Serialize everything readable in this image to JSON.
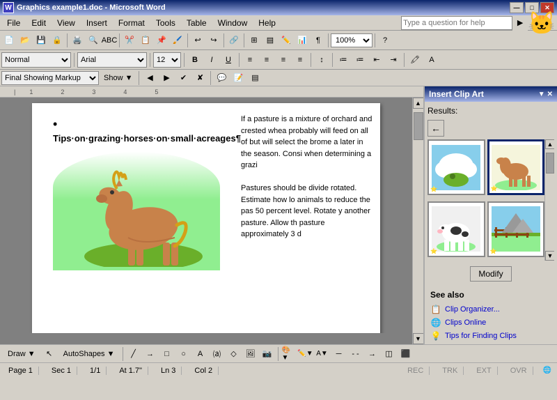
{
  "titlebar": {
    "title": "Graphics example1.doc - Microsoft Word",
    "minimize": "—",
    "maximize": "□",
    "close": "✕"
  },
  "menubar": {
    "items": [
      "File",
      "Edit",
      "View",
      "Insert",
      "Format",
      "Tools",
      "Table",
      "Window",
      "Help"
    ]
  },
  "toolbar": {
    "search_placeholder": "Type a question for help",
    "zoom": "100%"
  },
  "format_bar": {
    "style": "Normal",
    "font": "Arial",
    "size": "12"
  },
  "revision_bar": {
    "mode": "Final Showing Markup",
    "show": "Show ▼"
  },
  "document": {
    "bullet": "•",
    "title": "Tips·on·grazing·horses·on·small·acreages¶",
    "pasture_text1": "If a pasture is a mixture of orchard and crested whea probably will feed on all of but will select the brome a later in the season. Cons when determining a grazi",
    "pasture_text2": "Pastures should be divide rotated. Estimate how lo animals to reduce the pas 50 percent level. Rotate y another pasture. Allow th pasture approximately 3 d"
  },
  "clipart": {
    "panel_title": "Insert Clip Art",
    "results_label": "Results:",
    "modify_btn": "Modify",
    "see_also_label": "See also",
    "see_also_items": [
      {
        "icon": "📋",
        "label": "Clip Organizer..."
      },
      {
        "icon": "🌐",
        "label": "Clips Online"
      },
      {
        "icon": "💡",
        "label": "Tips for Finding Clips"
      }
    ]
  },
  "statusbar": {
    "page": "Page 1",
    "section": "Sec 1",
    "page_count": "1/1",
    "position": "At 1.7\"",
    "line": "Ln 3",
    "column": "Col 2",
    "rec": "REC",
    "trk": "TRK",
    "ext": "EXT",
    "ovr": "OVR"
  },
  "drawbar": {
    "draw_label": "Draw ▼",
    "autoshapes_label": "AutoShapes ▼"
  }
}
